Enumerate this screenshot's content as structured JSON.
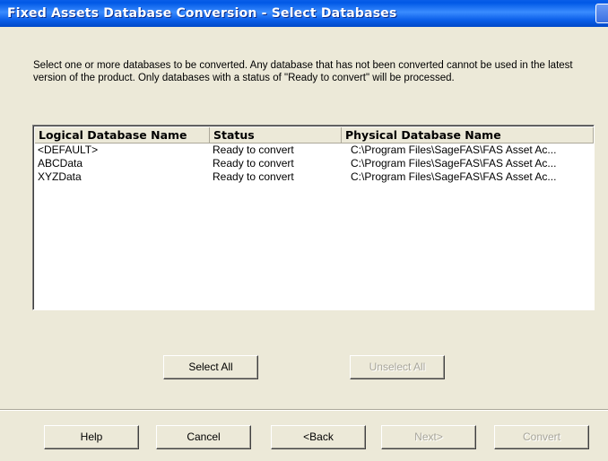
{
  "window": {
    "title": "Fixed Assets Database Conversion - Select Databases"
  },
  "description": "Select one or more databases to be converted. Any database that has not been converted cannot be used in the latest version of the product. Only databases with a status of \"Ready to convert\" will be processed.",
  "table": {
    "columns": [
      "Logical Database Name",
      "Status",
      "Physical Database Name"
    ],
    "rows": [
      [
        "<DEFAULT>",
        "Ready to convert",
        "C:\\Program Files\\SageFAS\\FAS Asset Ac..."
      ],
      [
        "ABCData",
        "Ready to convert",
        "C:\\Program Files\\SageFAS\\FAS Asset Ac..."
      ],
      [
        "XYZData",
        "Ready to convert",
        "C:\\Program Files\\SageFAS\\FAS Asset Ac..."
      ]
    ]
  },
  "selection_buttons": {
    "select_all": "Select All",
    "unselect_all": "Unselect All"
  },
  "nav_buttons": {
    "help": "Help",
    "cancel": "Cancel",
    "back": "<Back",
    "next": "Next>",
    "convert": "Convert"
  }
}
